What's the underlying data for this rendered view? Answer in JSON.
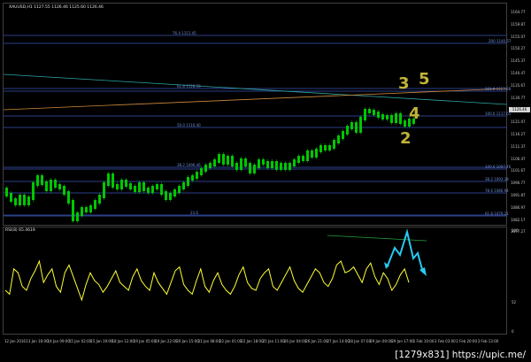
{
  "chart": {
    "title": "XAUUSD,H1  1127.55 1126.46 1125.60 1126.46",
    "symbol": "XAUUSD,H1",
    "ohlc": "1127.55 1126.46 1125.60 1126.46",
    "current_price": "1126.46",
    "bullish_color": "#00c800",
    "background": "#000000",
    "grid": false
  },
  "price_scale": [
    "1164.77",
    "1159.87",
    "1155.07",
    "1150.27",
    "1145.37",
    "1140.47",
    "1135.67",
    "1130.77",
    "1126.46",
    "1121.07",
    "1116.27",
    "1111.37",
    "1106.47",
    "1101.67",
    "1096.77",
    "1091.87",
    "1086.97",
    "1082.17",
    "1077.27"
  ],
  "rsi_scale": [
    "100",
    "52",
    "0"
  ],
  "fib_levels": [
    {
      "label": "76.4  1151.45",
      "side": "left"
    },
    {
      "label": "200  1140.57",
      "side": "right"
    },
    {
      "label": "61.8  1128.59",
      "side": "left"
    },
    {
      "label": "161.8  1123.88",
      "side": "right"
    },
    {
      "label": "100.0  1117.65",
      "side": "right"
    },
    {
      "label": "50.0  1116.40",
      "side": "left"
    },
    {
      "label": "38.2  1096.46",
      "side": "left"
    },
    {
      "label": "100.0  1097.46",
      "side": "right"
    },
    {
      "label": "38.2  1092.38",
      "side": "right"
    },
    {
      "label": "78.6  1086.94",
      "side": "right"
    },
    {
      "label": "23.6",
      "side": "left"
    },
    {
      "label": "61.8  1079.21",
      "side": "right"
    }
  ],
  "wave_labels": [
    "3",
    "5",
    "4",
    "2"
  ],
  "rsi": {
    "title": "RSI(8) 65.4619",
    "line_color": "#ffff33",
    "arrow_color": "#29c9f2"
  },
  "time_labels": [
    "12 Jan 2016",
    "13 Jan 16:00",
    "14 Jan 09:00",
    "15 Jan 02:00",
    "15 Jan 19:00",
    "18 Jan 12:00",
    "19 Jan 05:00",
    "19 Jan 22:00",
    "20 Jan 15:00",
    "21 Jan 08:00",
    "22 Jan 01:00",
    "22 Jan 18:00",
    "25 Jan 11:00",
    "26 Jan 04:00",
    "26 Jan 21:00",
    "27 Jan 14:00",
    "28 Jan 07:00",
    "29 Jan 00:00",
    "29 Jan 17:00",
    "1 Feb 10:00",
    "2 Feb 03:00",
    "2 Feb 20:00",
    "3 Feb 13:00"
  ],
  "watermark": "[1279x831] https://upic.me/"
}
